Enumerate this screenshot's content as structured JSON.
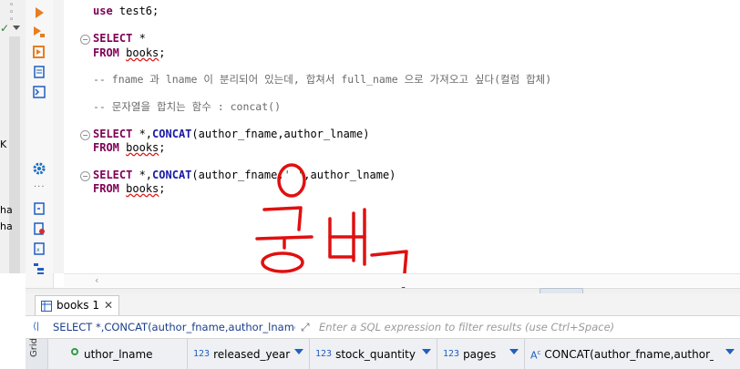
{
  "left_panel": {
    "cut_texts": [
      "K",
      "ha",
      "ha"
    ]
  },
  "editor": {
    "lines": [
      {
        "use_kw": "use",
        "use_rest": " test6;"
      },
      {
        "select": "SELECT",
        "star": " *"
      },
      {
        "from": "FROM",
        "table": "books",
        "semi": ";"
      },
      {
        "comment": "-- fname 과 lname 이 분리되어 있는데, 합쳐서 full_name 으로 가져오고 싶다(컬럼 합체)"
      },
      {
        "comment": "-- 문자열을 합치는 함수 : concat()"
      },
      {
        "select": "SELECT",
        "star": " *,",
        "fn": "CONCAT",
        "args": "(author_fname,author_lname)"
      },
      {
        "from": "FROM",
        "table": "books",
        "semi": ";"
      },
      {
        "select": "SELECT",
        "star": " *,",
        "fn": "CONCAT",
        "args1": "(author_fname,",
        "str": "' '",
        "args2": ",author_lname)"
      },
      {
        "from": "FROM",
        "table": "books",
        "semi": ";"
      }
    ]
  },
  "annotation": {
    "handwritten": "공백"
  },
  "results": {
    "tab_label": "books 1",
    "query_text": "SELECT *,CONCAT(author_fname,author_lname) F",
    "filter_placeholder": "Enter a SQL expression to filter results (use Ctrl+Space)",
    "grid_label": "Grid",
    "type_prefix": "123",
    "columns": [
      {
        "name": "uthor_lname"
      },
      {
        "name": "released_year"
      },
      {
        "name": "stock_quantity"
      },
      {
        "name": "pages"
      },
      {
        "name": "CONCAT(author_fname,author_ln"
      }
    ]
  },
  "colors": {
    "keyword": "#7f0055",
    "function": "#1a1aa6",
    "annotation": "#e01010",
    "warning": "#c62828"
  }
}
